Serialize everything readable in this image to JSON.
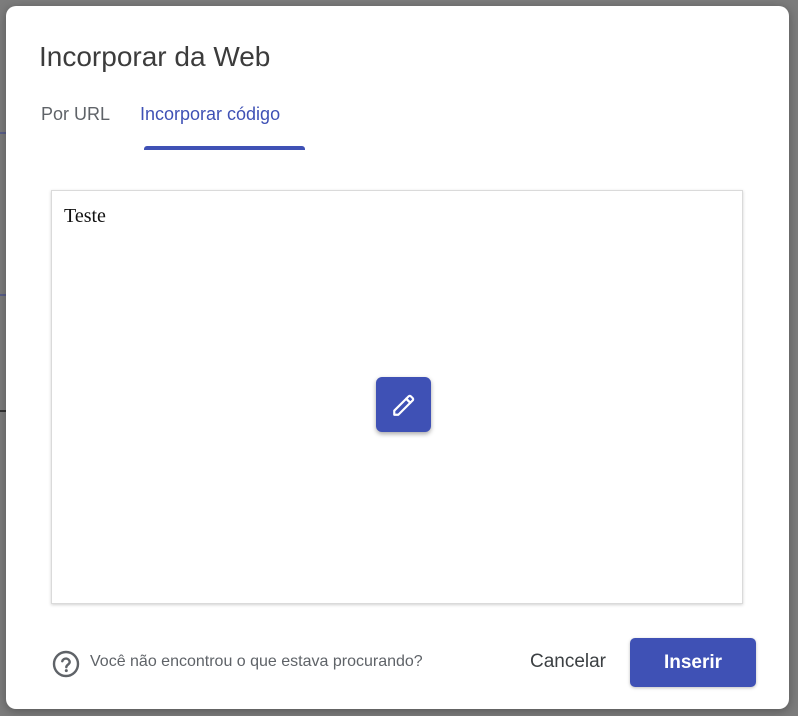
{
  "dialog": {
    "title": "Incorporar da Web",
    "tabs": [
      {
        "label": "Por URL",
        "active": false
      },
      {
        "label": "Incorporar código",
        "active": true
      }
    ],
    "editor": {
      "content": "Teste",
      "edit_icon": "pencil-icon"
    },
    "help": {
      "icon": "question-circle-icon",
      "text": "Você não encontrou o que estava procurando?"
    },
    "actions": {
      "cancel_label": "Cancelar",
      "insert_label": "Inserir"
    },
    "colors": {
      "accent": "#3f51b5",
      "text": "#3c3c3c",
      "muted": "#5f6368"
    }
  }
}
